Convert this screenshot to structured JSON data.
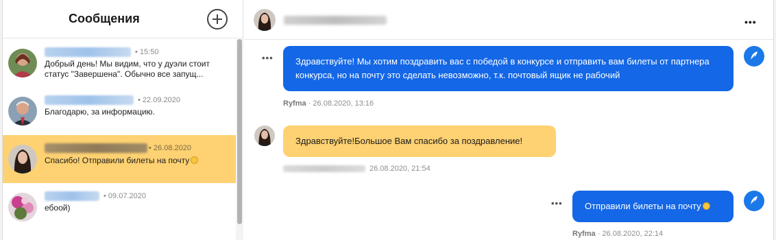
{
  "sidebar": {
    "title": "Сообщения",
    "conversations": [
      {
        "time": "• 15:50",
        "text": "Добрый день! Мы видим, что у дуэли стоит статус \"Завершена\". Обычно все запущ..."
      },
      {
        "time": "• 22.09.2020",
        "text": "Благодарю, за информацию."
      },
      {
        "time": "• 26.08.2020",
        "text": "Спасибо! Отправили билеты на почту"
      },
      {
        "time": "• 09.07.2020",
        "text": "ебоой)"
      }
    ]
  },
  "chat": {
    "more_label": "•••",
    "messages": [
      {
        "direction": "out",
        "text": "Здравствуйте! Мы хотим поздравить вас с победой в конкурсе и отправить вам билеты от партнера конкурса, но на почту это сделать невозможно, т.к. почтовый ящик не рабочий",
        "author": "Ryfma",
        "timestamp": "· 26.08.2020, 13:16"
      },
      {
        "direction": "in",
        "text": "Здравствуйте!Большое Вам спасибо за поздравление!",
        "timestamp": "26.08.2020, 21:54"
      },
      {
        "direction": "out",
        "text": "Отправили билеты на почту",
        "author": "Ryfma",
        "timestamp": "· 26.08.2020, 22:14"
      }
    ]
  },
  "colors": {
    "accent_blue": "#1467e6",
    "highlight_yellow": "#fed172"
  },
  "icons": [
    "compose-plus-icon",
    "more-options-icon",
    "quill-feather-icon",
    "smile-emoji-icon"
  ]
}
